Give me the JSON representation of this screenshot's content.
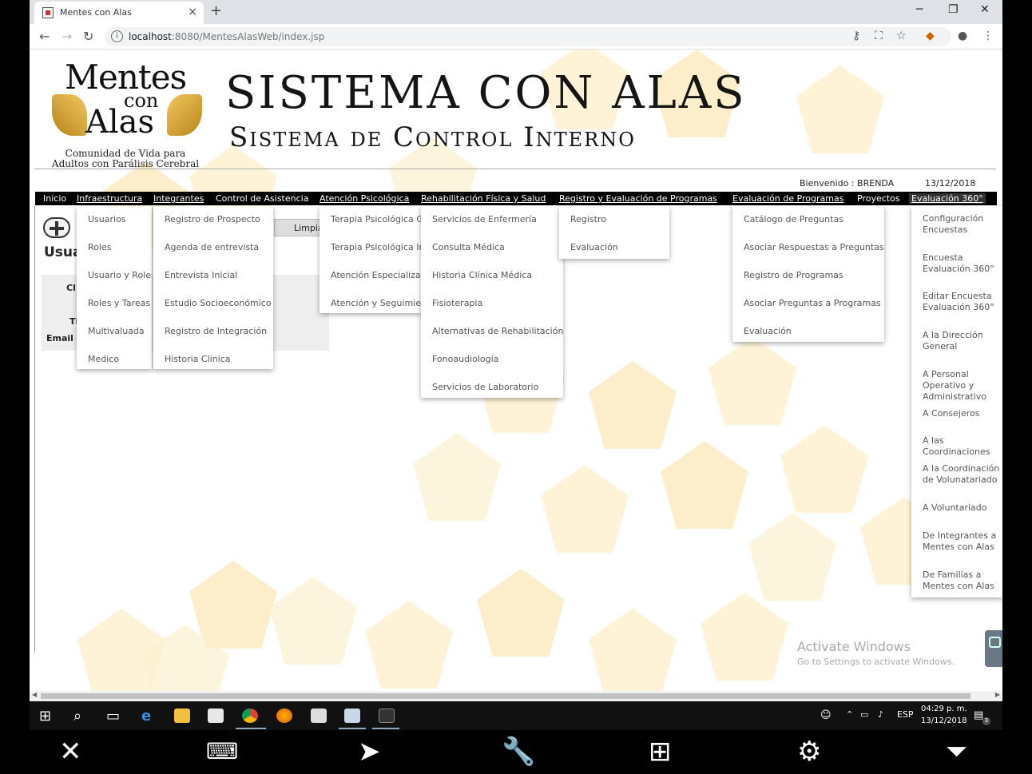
{
  "browser": {
    "tab_title": "Mentes con Alas",
    "tab_close": "×",
    "new_tab": "+",
    "url_host": "localhost",
    "url_rest": ":8080/MentesAlasWeb/index.jsp",
    "window_min": "─",
    "window_max": "❐",
    "window_close": "✕"
  },
  "header": {
    "logo_line1": "Mentes",
    "logo_line2": "con",
    "logo_line3": "Alas",
    "logo_subtitle_1": "Comunidad de Vida para",
    "logo_subtitle_2": "Adultos con Parálisis Cerebral",
    "title": "SISTEMA CON ALAS",
    "subtitle": "Sistema de Control Interno",
    "welcome": "Bienvenido : BRENDA",
    "date": "13/12/2018"
  },
  "menu": [
    {
      "label": "Inicio"
    },
    {
      "label": "Infraestructura"
    },
    {
      "label": "Integrantes"
    },
    {
      "label": "Control de Asistencia"
    },
    {
      "label": "Atención Psicológica"
    },
    {
      "label": "Rehabilitación Física y Salud"
    },
    {
      "label": "Registro y Evaluación de Programas"
    },
    {
      "label": "Evaluación de Programas"
    },
    {
      "label": "Proyectos"
    },
    {
      "label": "Evaluación 360°"
    }
  ],
  "dropdowns": {
    "infraestructura": [
      "Usuarios",
      "Roles",
      "Usuario y Roles",
      "Roles y Tareas",
      "Multivaluada",
      "Medico"
    ],
    "integrantes": [
      "Registro de Prospecto",
      "Agenda de entrevista",
      "Entrevista Inicial",
      "Estudio Socioeconómico",
      "Registro de Integración",
      "Historia Clinica"
    ],
    "atencion_psicologica": [
      "Terapia Psicológica Gr",
      "Terapia Psicológica In",
      "Atención Especializada",
      "Atención y Seguimient"
    ],
    "rehabilitacion": [
      "Servicios de Enfermería",
      "Consulta Médica",
      "Historia Clínica Médica",
      "Fisioterapia",
      "Alternativas de Rehabilitación",
      "Fonoaudiología",
      "Servicios de Laboratorio"
    ],
    "registro_evaluacion": [
      "Registro",
      "Evaluación"
    ],
    "evaluacion_programas": [
      "Catálogo de Preguntas",
      "Asociar Respuestas a Preguntas",
      "Registro de Programas",
      "Asociar Preguntas a Programas",
      "Evaluación"
    ],
    "evaluacion_360": [
      "Configuración Encuestas",
      "Encuesta Evaluación 360°",
      "Editar Encuesta Evaluación 360°",
      "A la Dirección General",
      "A Personal Operativo y Administrativo",
      "A Consejeros",
      "A las Coordinaciones",
      "A la Coordinación de Volunatariado",
      "A Voluntariado",
      "De Integrantes a Mentes con Alas",
      "De Familias a Mentes con Alas"
    ]
  },
  "content": {
    "limpiar": "Limpia",
    "section_title": "Usua",
    "label_cl": "Cl",
    "label_ti": "Ti",
    "label_email": "Email"
  },
  "watermark": {
    "line1": "Activate Windows",
    "line2": "Go to Settings to activate Windows."
  },
  "taskbar": {
    "lang": "ESP",
    "time": "04:29 p. m.",
    "date": "13/12/2018",
    "notif_count": "3"
  },
  "colors": {
    "menu_bg": "#000000",
    "hex_light": "#fde9b6",
    "hex_gold": "#f9d98a"
  }
}
